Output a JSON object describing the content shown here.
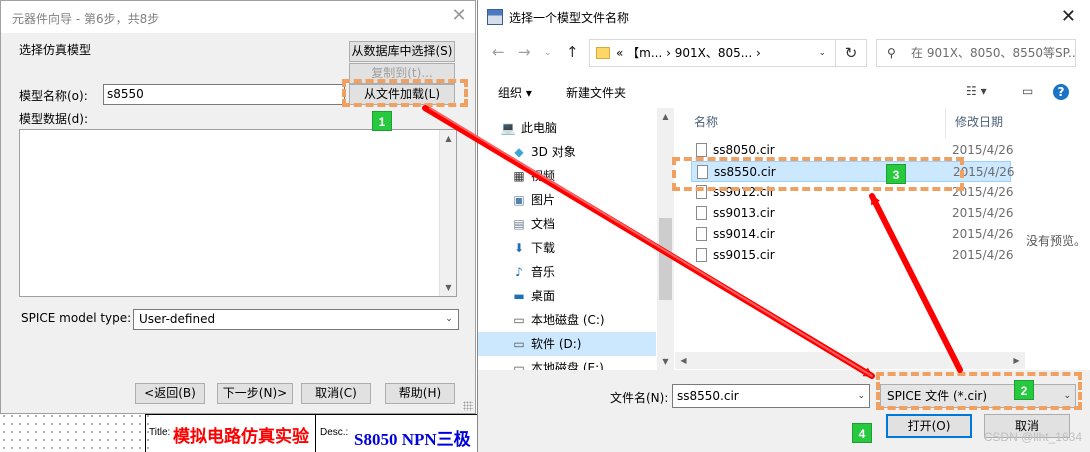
{
  "background": {
    "title_label": "Title:",
    "title_value": "模拟电路仿真实验",
    "desc_label": "Desc.:",
    "desc_value": "S8050 NPN三极"
  },
  "wizard": {
    "title": "元器件向导 - 第6步，共8步",
    "section_title": "选择仿真模型",
    "btn_from_db": "从数据库中选择(S)",
    "btn_copy_to": "复制到(t)...",
    "btn_load_file": "从文件加载(L)",
    "model_name_label": "模型名称(o):",
    "model_name_value": "s8550",
    "model_data_label": "模型数据(d):",
    "spice_type_label": "SPICE model type:",
    "spice_type_value": "User-defined",
    "btn_back": "<返回(B)",
    "btn_next": "下一步(N)>",
    "btn_cancel": "取消(C)",
    "btn_help": "帮助(H)"
  },
  "file_dialog": {
    "title": "选择一个模型文件名称",
    "address": "«  【m...  ›  901X、805...  ›",
    "search_placeholder": "在 901X、8050、8550等SP...",
    "organize": "组织 ▾",
    "new_folder": "新建文件夹",
    "nav_items": [
      {
        "label": "此电脑",
        "icon": "💻"
      },
      {
        "label": "3D 对象",
        "icon": "◆"
      },
      {
        "label": "视频",
        "icon": "▦"
      },
      {
        "label": "图片",
        "icon": "▣"
      },
      {
        "label": "文档",
        "icon": "▤"
      },
      {
        "label": "下载",
        "icon": "⬇"
      },
      {
        "label": "音乐",
        "icon": "♪"
      },
      {
        "label": "桌面",
        "icon": "▬"
      },
      {
        "label": "本地磁盘 (C:)",
        "icon": "▭"
      },
      {
        "label": "软件 (D:)",
        "icon": "▭"
      },
      {
        "label": "本地磁盘 (E:)",
        "icon": "▭"
      }
    ],
    "col_name": "名称",
    "col_date": "修改日期",
    "files": [
      {
        "name": "ss8050.cir",
        "date": "2015/4/26"
      },
      {
        "name": "ss8550.cir",
        "date": "2015/4/26"
      },
      {
        "name": "ss9012.cir",
        "date": "2015/4/26"
      },
      {
        "name": "ss9013.cir",
        "date": "2015/4/26"
      },
      {
        "name": "ss9014.cir",
        "date": "2015/4/26"
      },
      {
        "name": "ss9015.cir",
        "date": "2015/4/26"
      }
    ],
    "no_preview": "没有预览。",
    "filename_label": "文件名(N):",
    "filename_value": "ss8550.cir",
    "filetype_value": "SPICE 文件 (*.cir)",
    "btn_open": "打开(O)",
    "btn_cancel": "取消"
  },
  "badges": [
    "1",
    "2",
    "3",
    "4"
  ],
  "watermark": "CSDN @llht_1634",
  "colors": {
    "highlight": "#f0a060",
    "badge": "#27c93f",
    "arrow": "#ff0000",
    "selection": "#cce8ff"
  }
}
